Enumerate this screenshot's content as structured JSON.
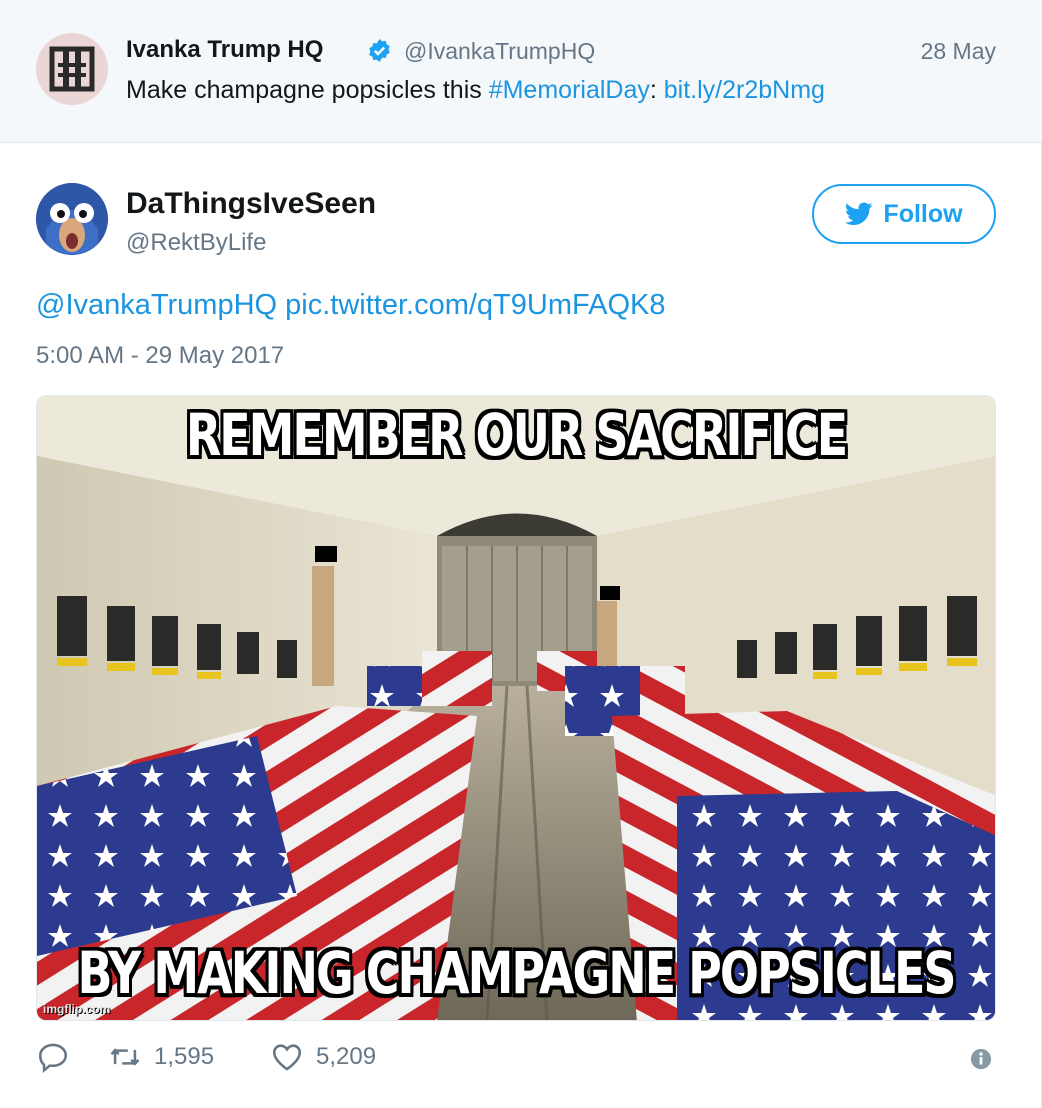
{
  "parent_tweet": {
    "author_name": "Ivanka Trump HQ",
    "handle": "@IvankaTrumpHQ",
    "date": "28 May",
    "text_prefix": "Make champagne popsicles this ",
    "hashtag": "#MemorialDay",
    "text_separator": ": ",
    "link": "bit.ly/2r2bNmg",
    "avatar_icon": "ivanka-hq-logo",
    "verified_icon": "verified-badge-icon"
  },
  "tweet": {
    "author_name": "DaThingsIveSeen",
    "handle": "@RektByLife",
    "follow_label": "Follow",
    "mention": "@IvankaTrumpHQ",
    "pic_link": "pic.twitter.com/qT9UmFAQK8",
    "timestamp": "5:00 AM - 29 May 2017",
    "media": {
      "top_caption": "REMEMBER OUR SACRIFICE",
      "bottom_caption": "BY MAKING CHAMPAGNE POPSICLES",
      "watermark": "imgflip.com"
    },
    "actions": {
      "retweet_count": "1,595",
      "like_count": "5,209"
    }
  },
  "colors": {
    "link": "#1b95e0",
    "twitter_blue": "#1da1f2",
    "muted": "#657786",
    "band_bg": "#f5f8fa"
  }
}
